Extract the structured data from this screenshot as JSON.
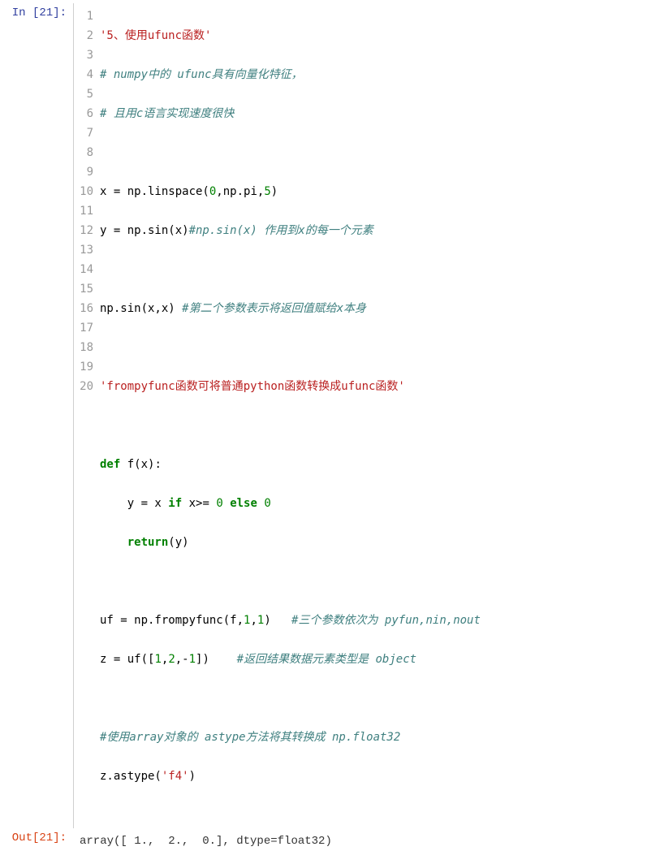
{
  "input": {
    "prompt": "In [21]:",
    "gutter": [
      "1",
      "2",
      "3",
      "4",
      "5",
      "6",
      "7",
      "8",
      "9",
      "10",
      "11",
      "12",
      "13",
      "14",
      "15",
      "16",
      "17",
      "18",
      "19",
      "20"
    ],
    "tokens": {
      "l1_s": "'5、使用ufunc函数'",
      "l2_c": "# numpy中的 ufunc具有向量化特征，",
      "l3_c": "# 且用c语言实现速度很快",
      "l5_a": "x = np.linspace(",
      "l5_n1": "0",
      "l5_b": ",np.pi,",
      "l5_n2": "5",
      "l5_c": ")",
      "l6_a": "y = np.sin(x)",
      "l6_c": "#np.sin(x) 作用到x的每一个元素",
      "l8_a": "np.sin(x,x) ",
      "l8_c": "#第二个参数表示将返回值赋给x本身",
      "l10_s": "'frompyfunc函数可将普通python函数转换成ufunc函数'",
      "l12_def": "def",
      "l12_a": " f(x):",
      "l13_pad": "    y = x ",
      "l13_if": "if",
      "l13_b": " x>= ",
      "l13_n0": "0",
      "l13_sp": " ",
      "l13_else": "else",
      "l13_sp2": " ",
      "l13_n0b": "0",
      "l14_pad": "    ",
      "l14_ret": "return",
      "l14_a": "(y)",
      "l16_a": "uf = np.frompyfunc(f,",
      "l16_n1": "1",
      "l16_b": ",",
      "l16_n2": "1",
      "l16_c": ")   ",
      "l16_cm": "#三个参数依次为 pyfun,nin,nout",
      "l17_a": "z = uf([",
      "l17_n1": "1",
      "l17_b": ",",
      "l17_n2": "2",
      "l17_c": ",-",
      "l17_n3": "1",
      "l17_d": "])    ",
      "l17_cm": "#返回结果数据元素类型是 object",
      "l19_c": "#使用array对象的 astype方法将其转换成 np.float32",
      "l20_a": "z.astype(",
      "l20_s": "'f4'",
      "l20_b": ")"
    }
  },
  "output": {
    "prompt": "Out[21]:",
    "text": "array([ 1.,  2.,  0.], dtype=float32)"
  }
}
